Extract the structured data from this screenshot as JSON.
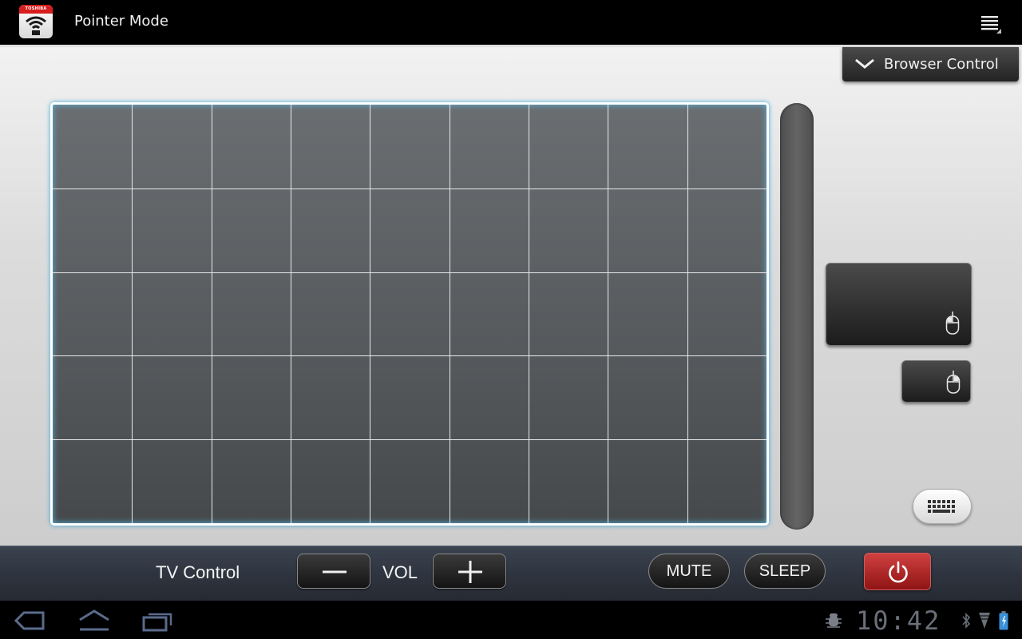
{
  "action_bar": {
    "brand": "TOSHIBA",
    "title": "Pointer Mode",
    "menu_icon": "overflow-menu-icon"
  },
  "pointer_panel": {
    "browser_control_label": "Browser Control",
    "grid": {
      "columns": 9,
      "rows": 5
    },
    "left_click_icon": "mouse-icon",
    "right_click_icon": "mouse-icon",
    "keyboard_icon": "keyboard-icon",
    "accent_color": "#3fa9d6"
  },
  "tv_control": {
    "label": "TV Control",
    "vol_label": "VOL",
    "mute_label": "MUTE",
    "sleep_label": "SLEEP",
    "power_icon": "power-icon",
    "power_color": "#b52222"
  },
  "system_bar": {
    "time": "10:42",
    "icons": [
      "back-icon",
      "home-icon",
      "recent-apps-icon",
      "debug-icon",
      "bluetooth-icon",
      "signal-icon",
      "battery-icon"
    ]
  }
}
